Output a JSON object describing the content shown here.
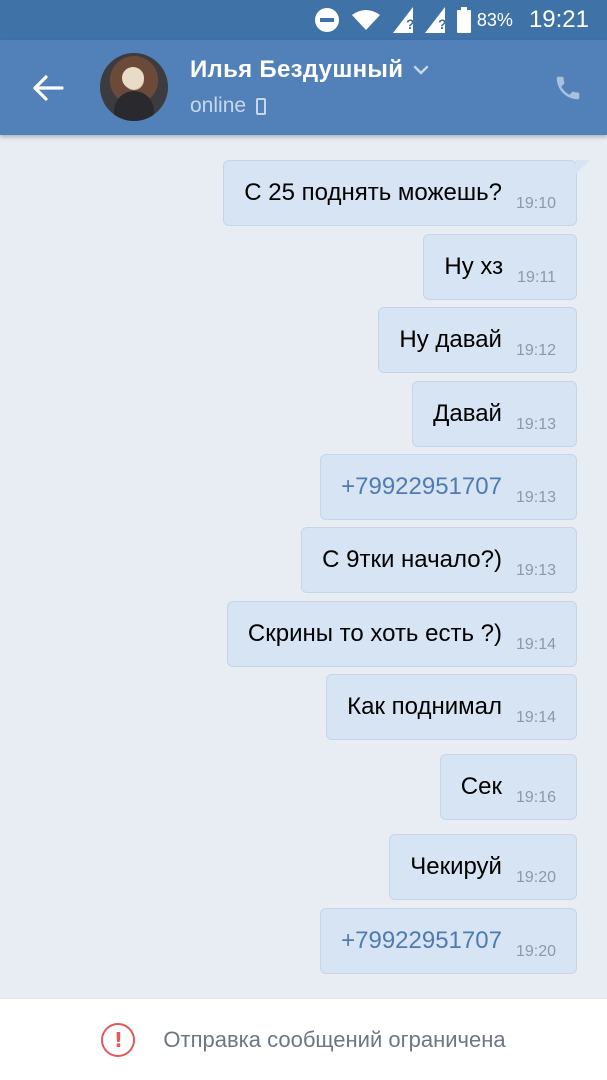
{
  "status_bar": {
    "battery": "83%",
    "time": "19:21",
    "sim_marks": [
      "?",
      "?"
    ]
  },
  "header": {
    "contact_name": "Илья Бездушный",
    "status": "online"
  },
  "messages": [
    {
      "text": "С 25 поднять можешь?",
      "time": "19:10",
      "is_link": false
    },
    {
      "text": "Ну хз",
      "time": "19:11",
      "is_link": false
    },
    {
      "text": "Ну давай",
      "time": "19:12",
      "is_link": false
    },
    {
      "text": "Давай",
      "time": "19:13",
      "is_link": false
    },
    {
      "text": "+79922951707",
      "time": "19:13",
      "is_link": true
    },
    {
      "text": "С 9тки начало?)",
      "time": "19:13",
      "is_link": false
    },
    {
      "text": "Скрины то хоть есть ?)",
      "time": "19:14",
      "is_link": false
    },
    {
      "text": "Как поднимал",
      "time": "19:14",
      "is_link": false
    },
    {
      "text": "Сек",
      "time": "19:16",
      "is_link": false
    },
    {
      "text": "Чекируй",
      "time": "19:20",
      "is_link": false
    },
    {
      "text": "+79922951707",
      "time": "19:20",
      "is_link": true
    }
  ],
  "footer": {
    "restriction_text": "Отправка сообщений ограничена"
  },
  "colors": {
    "status_bar": "#3f73a8",
    "header": "#5181b8",
    "chat_bg": "#e7edf3",
    "bubble": "#d7e4f3",
    "link": "#4f7bb0",
    "warning": "#e05a5a"
  },
  "icons": {
    "back": "arrow-left-icon",
    "call": "phone-icon",
    "dropdown": "chevron-down-icon",
    "warning": "exclamation-circle-icon"
  }
}
